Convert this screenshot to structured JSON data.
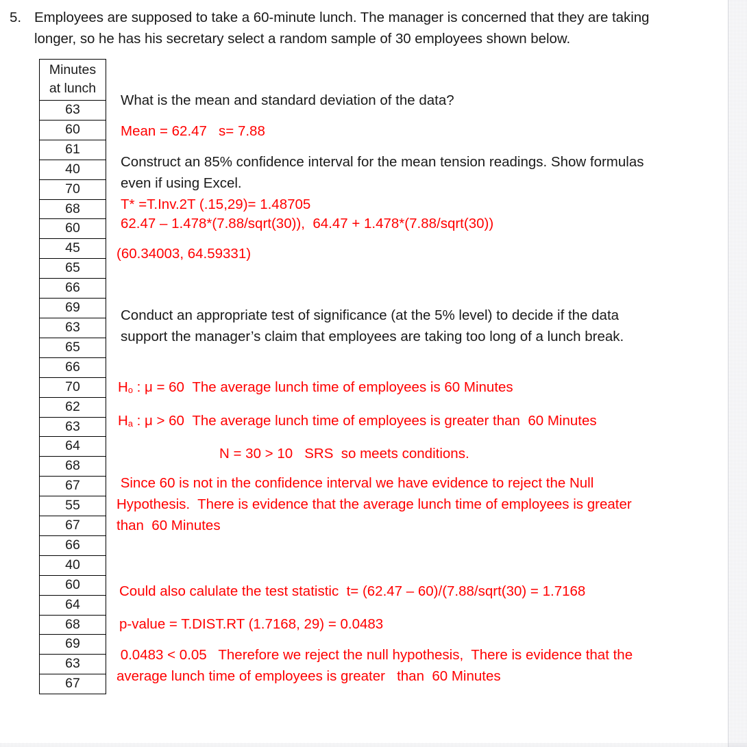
{
  "question": {
    "number": "5.",
    "stem": "Employees are supposed to take a 60-minute lunch. The manager is concerned that they are taking longer, so he has his secretary select a random sample of 30 employees shown below.",
    "part_a_prompt": "What is the mean and standard deviation of the data?",
    "part_b_prompt": "Construct an 85% confidence interval for the mean tension readings. Show formulas even if using Excel.",
    "part_c_prompt": "Conduct an appropriate test of significance (at the 5% level) to decide if the data support the manager’s claim that employees are taking too long of a lunch break."
  },
  "table": {
    "header_line1": "Minutes",
    "header_line2": "at lunch",
    "values": [
      "63",
      "60",
      "61",
      "40",
      "70",
      "68",
      "60",
      "45",
      "65",
      "66",
      "69",
      "63",
      "65",
      "66",
      "70",
      "62",
      "63",
      "64",
      "68",
      "67",
      "55",
      "67",
      "66",
      "40",
      "60",
      "64",
      "68",
      "69",
      "63",
      "67"
    ]
  },
  "answers": {
    "mean_sd": "Mean = 62.47   s= 7.88",
    "ci_tstar": "T* =T.Inv.2T (.15,29)= 1.48705",
    "ci_formula": "62.47 – 1.478*(7.88/sqrt(30)),  64.47 + 1.478*(7.88/sqrt(30))",
    "ci_result": "(60.34003, 64.59331)",
    "h0_symbol": "H",
    "h0_subscript": "o",
    "h0_rest": " : μ = 60  The average lunch time of employees is 60 Minutes",
    "ha_symbol": "H",
    "ha_subscript": "a",
    "ha_rest": " : μ > 60  The average lunch time of employees is greater than  60 Minutes",
    "conditions": "N = 30 > 10   SRS  so meets conditions.",
    "conclusion": " Since 60 is not in the confidence interval we have evidence to reject the Null Hypothesis.  There is evidence that the average lunch time of employees is greater than  60 Minutes",
    "test_statistic": "Could also calulate the test statistic  t= (62.47 – 60)/(7.88/sqrt(30) = 1.7168",
    "p_value": "p-value = T.DIST.RT (1.7168, 29) = 0.0483",
    "final_conclusion": " 0.0483 < 0.05   Therefore we reject the null hypothesis,  There is evidence that the average lunch time of employees is greater   than  60 Minutes"
  },
  "colors": {
    "answer_red": "#ff0000",
    "body_black": "#1a1a1a",
    "table_border": "#000000",
    "page_background": "#ffffff"
  }
}
